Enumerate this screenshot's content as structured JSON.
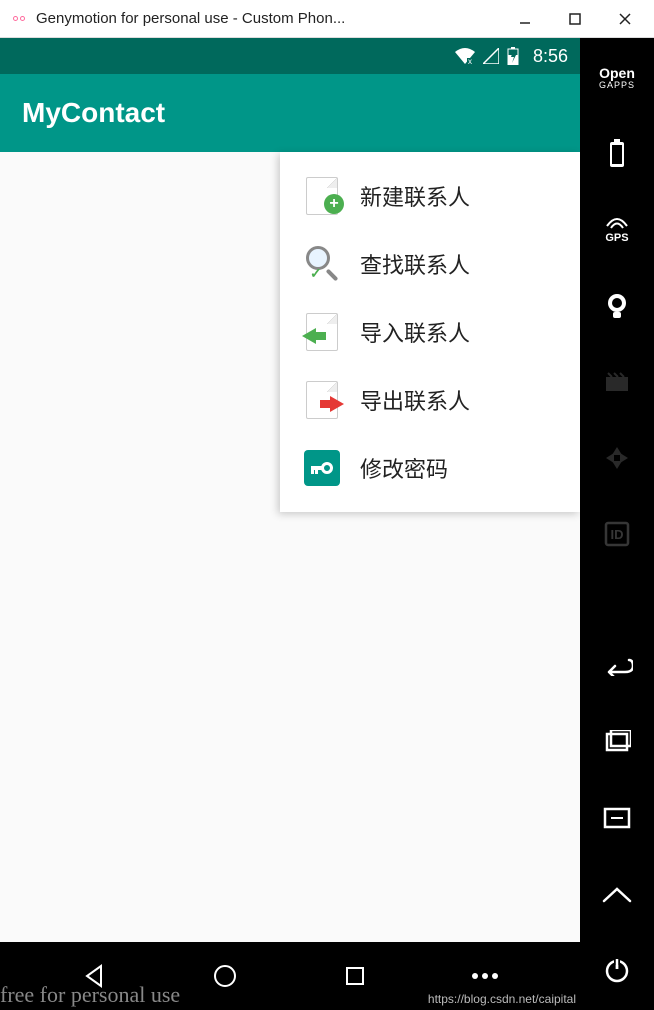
{
  "window": {
    "title": "Genymotion for personal use - Custom Phon..."
  },
  "status": {
    "time": "8:56"
  },
  "app": {
    "title": "MyContact"
  },
  "menu": {
    "items": [
      {
        "label": "新建联系人",
        "icon": "add-contact-icon"
      },
      {
        "label": "查找联系人",
        "icon": "search-contact-icon"
      },
      {
        "label": "导入联系人",
        "icon": "import-contact-icon"
      },
      {
        "label": "导出联系人",
        "icon": "export-contact-icon"
      },
      {
        "label": "修改密码",
        "icon": "change-password-icon"
      }
    ]
  },
  "sidebar": {
    "open_label": "Open",
    "open_sublabel": "GAPPS",
    "gps_label": "GPS",
    "id_label": "ID"
  },
  "watermark": {
    "left": "free for personal use",
    "right": "https://blog.csdn.net/caipital"
  }
}
